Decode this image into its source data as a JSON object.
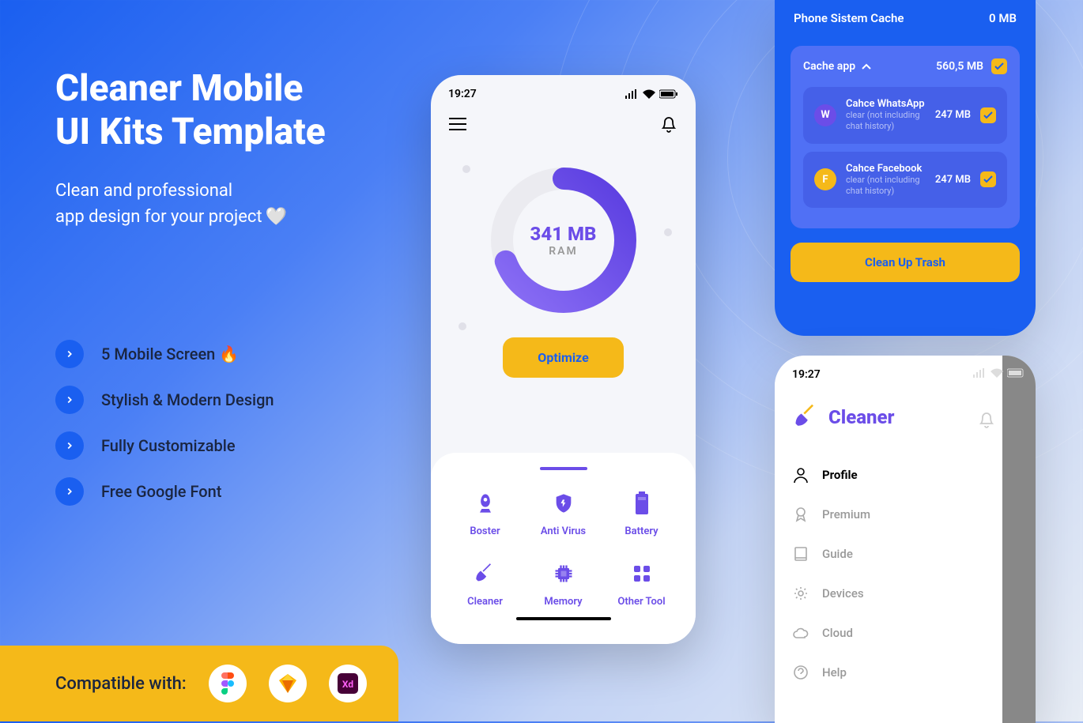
{
  "hero": {
    "title_l1": "Cleaner Mobile",
    "title_l2": "UI Kits Template",
    "sub_l1": "Clean and professional",
    "sub_l2": "app design for your project"
  },
  "features": [
    "5 Mobile Screen 🔥",
    "Stylish & Modern Design",
    "Fully Customizable",
    "Free Google Font"
  ],
  "compat": {
    "label": "Compatible with:",
    "apps": [
      "figma",
      "sketch",
      "xd"
    ]
  },
  "phone1": {
    "time": "19:27",
    "ram_value": "341 MB",
    "ram_label": "RAM",
    "optimize": "Optimize",
    "tools": [
      "Boster",
      "Anti Virus",
      "Battery",
      "Cleaner",
      "Memory",
      "Other Tool"
    ]
  },
  "phone2": {
    "system_cache": {
      "label": "Phone Sistem Cache",
      "size": "0 MB"
    },
    "cache_app": {
      "label": "Cache app",
      "size": "560,5 MB"
    },
    "items": [
      {
        "name": "Cahce WhatsApp",
        "desc": "clear (not including chat history)",
        "size": "247 MB",
        "color": "#6b4de8",
        "letter": "W"
      },
      {
        "name": "Cahce Facebook",
        "desc": "clear (not including chat history)",
        "size": "247 MB",
        "color": "#f5b919",
        "letter": "F"
      }
    ],
    "clean_btn": "Clean Up Trash"
  },
  "phone3": {
    "time": "19:27",
    "brand": "Cleaner",
    "menu": [
      "Profile",
      "Premium",
      "Guide",
      "Devices",
      "Cloud",
      "Help"
    ]
  }
}
